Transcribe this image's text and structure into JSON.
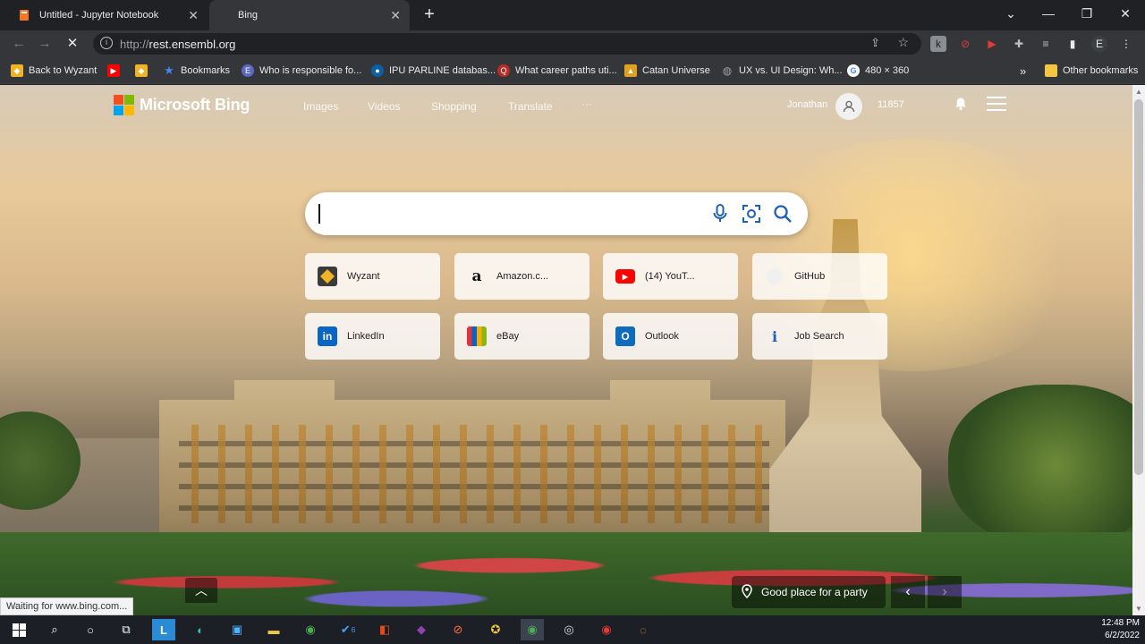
{
  "tabs": [
    {
      "title": "Untitled - Jupyter Notebook",
      "icon": "jupyter-icon",
      "active": false
    },
    {
      "title": "Bing",
      "icon": "bing-icon",
      "active": true
    }
  ],
  "address_bar": {
    "protocol": "http://",
    "host": "rest.ensembl.org"
  },
  "bookmarks": [
    {
      "label": "Back to Wyzant",
      "icon": "wyzant-icon",
      "color": "#f0b323"
    },
    {
      "label": "",
      "icon": "youtube-icon",
      "color": "#ff0000"
    },
    {
      "label": "",
      "icon": "wyzant-icon",
      "color": "#f0b323"
    },
    {
      "label": "Bookmarks",
      "icon": "star-icon",
      "color": "#4285f4"
    },
    {
      "label": "Who is responsible fo...",
      "icon": "e-icon",
      "color": "#5b6abf"
    },
    {
      "label": "IPU PARLINE databas...",
      "icon": "ipu-icon",
      "color": "#0b5fa5"
    },
    {
      "label": "What career paths uti...",
      "icon": "quora-icon",
      "color": "#b92b27"
    },
    {
      "label": "Catan Universe",
      "icon": "catan-icon",
      "color": "#e0a020"
    },
    {
      "label": "UX vs. UI Design: Wh...",
      "icon": "globe-icon",
      "color": "#9aa0a6"
    },
    {
      "label": "480 × 360",
      "icon": "google-icon",
      "color": "#ffffff"
    }
  ],
  "other_bookmarks": "Other bookmarks",
  "bing": {
    "logo_text": "Microsoft Bing",
    "nav": [
      "Images",
      "Videos",
      "Shopping",
      "Translate",
      "···"
    ],
    "user_name": "Jonathan",
    "points": "11857",
    "search_placeholder": "",
    "tiles": [
      {
        "label": "Wyzant",
        "icon": "wyzant-icon"
      },
      {
        "label": "Amazon.c...",
        "icon": "amazon-icon"
      },
      {
        "label": "(14) YouT...",
        "icon": "youtube-icon"
      },
      {
        "label": "GitHub",
        "icon": "github-icon"
      },
      {
        "label": "LinkedIn",
        "icon": "linkedin-icon"
      },
      {
        "label": "eBay",
        "icon": "ebay-icon"
      },
      {
        "label": "Outlook",
        "icon": "outlook-icon"
      },
      {
        "label": "Job Search",
        "icon": "job-search-icon"
      }
    ],
    "location_label": "Good place for a party"
  },
  "status_text": "Waiting for www.bing.com...",
  "taskbar": {
    "time": "12:48 PM",
    "date": "6/2/2022",
    "badge": "6"
  }
}
